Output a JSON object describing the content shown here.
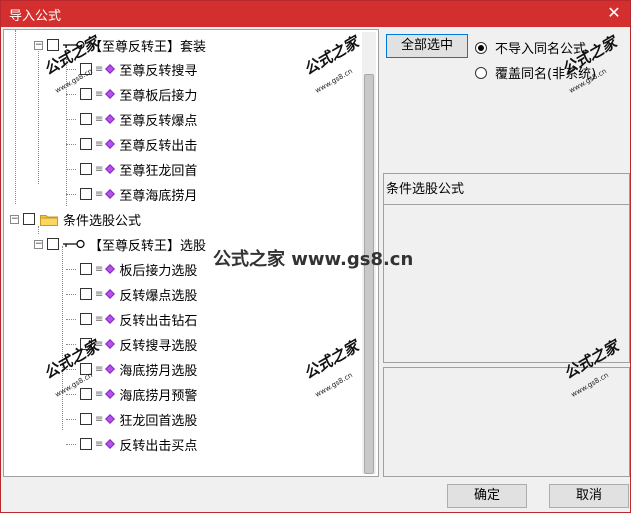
{
  "window": {
    "title": "导入公式",
    "close_glyph": "✕"
  },
  "tree": {
    "rows": [
      {
        "label": "【至尊反转王】套装",
        "type": "key-group"
      },
      {
        "label": "至尊反转搜寻",
        "type": "leaf"
      },
      {
        "label": "至尊板后接力",
        "type": "leaf"
      },
      {
        "label": "至尊反转爆点",
        "type": "leaf"
      },
      {
        "label": "至尊反转出击",
        "type": "leaf"
      },
      {
        "label": "至尊狂龙回首",
        "type": "leaf"
      },
      {
        "label": "至尊海底捞月",
        "type": "leaf"
      },
      {
        "label": "条件选股公式",
        "type": "folder"
      },
      {
        "label": "【至尊反转王】选股",
        "type": "key-group"
      },
      {
        "label": "板后接力选股",
        "type": "leaf"
      },
      {
        "label": "反转爆点选股",
        "type": "leaf"
      },
      {
        "label": "反转出击钻石",
        "type": "leaf"
      },
      {
        "label": "反转搜寻选股",
        "type": "leaf"
      },
      {
        "label": "海底捞月选股",
        "type": "leaf"
      },
      {
        "label": "海底捞月预警",
        "type": "leaf"
      },
      {
        "label": "狂龙回首选股",
        "type": "leaf"
      },
      {
        "label": "反转出击买点",
        "type": "leaf"
      }
    ]
  },
  "right": {
    "select_all_label": "全部选中",
    "radio_skip_label": "不导入同名公式",
    "radio_overwrite_label": "覆盖同名(非系统)",
    "info_label": "条件选股公式"
  },
  "footer": {
    "ok_label": "确定",
    "cancel_label": "取消"
  },
  "watermark": {
    "stamp": "公式之家",
    "site": "www.gs8.cn",
    "center": "公式之家 www.gs8.cn"
  },
  "colors": {
    "titlebar": "#d32f2f",
    "diamond": "#8e1fd0"
  }
}
